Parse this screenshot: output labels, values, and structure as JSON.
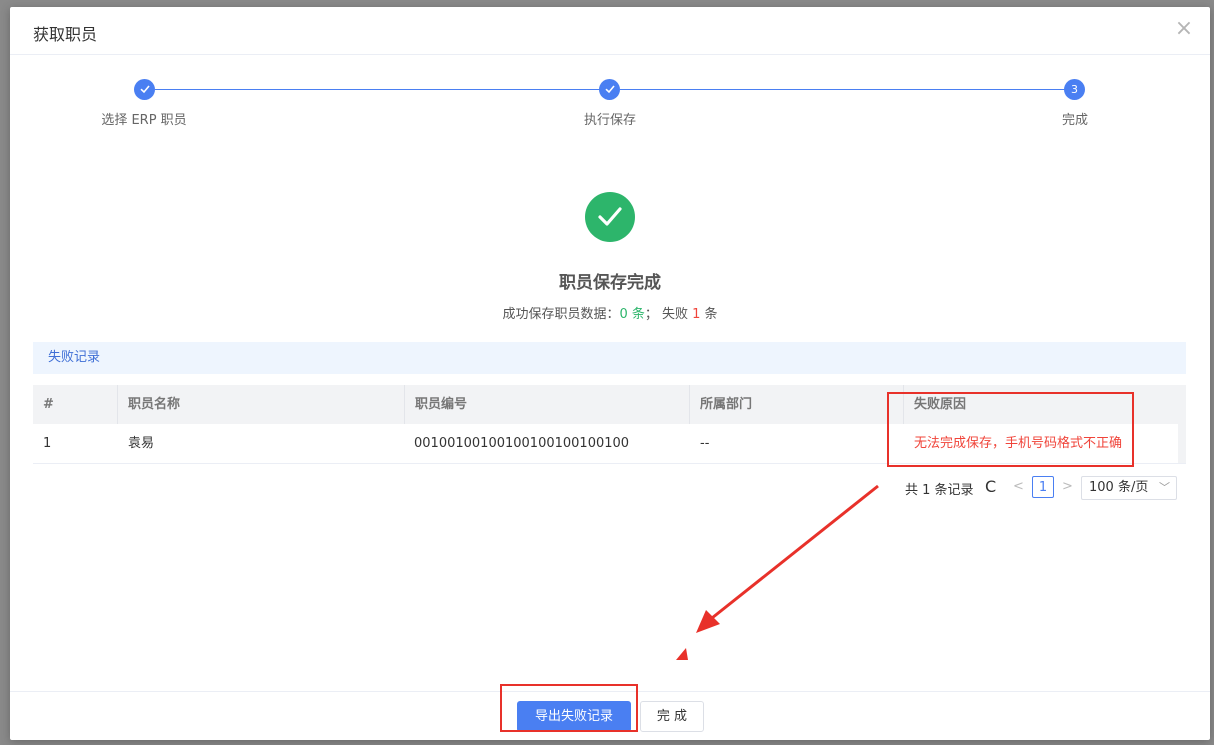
{
  "modal": {
    "title": "获取职员",
    "close_icon": "×"
  },
  "steps": [
    {
      "label": "选择 ERP 职员",
      "state": "done"
    },
    {
      "label": "执行保存",
      "state": "done"
    },
    {
      "label": "完成",
      "state": "current",
      "number": "3"
    }
  ],
  "result": {
    "title": "职员保存完成",
    "summary_prefix": "成功保存职员数据：",
    "success_count": "0 条",
    "separator": "；  失败 ",
    "fail_count": "1",
    "fail_unit": " 条"
  },
  "fail_section": {
    "title": "失败记录"
  },
  "table": {
    "columns": [
      "#",
      "职员名称",
      "职员编号",
      "所属部门",
      "失败原因"
    ],
    "rows": [
      {
        "index": "1",
        "name": "袁易",
        "code": "00100100100100100100100100",
        "dept": "--",
        "reason": "无法完成保存，手机号码格式不正确"
      }
    ]
  },
  "pagination": {
    "total": "共 1 条记录",
    "refresh_icon": "C",
    "prev_icon": "<",
    "page": "1",
    "next_icon": ">",
    "page_size": "100 条/页",
    "chevron": "﹀"
  },
  "footer": {
    "export_button": "导出失败记录",
    "done_button": "完 成"
  },
  "colors": {
    "primary": "#4a7ff2",
    "success": "#2db56b",
    "error": "#f0443a",
    "annotation": "#e8312a"
  }
}
